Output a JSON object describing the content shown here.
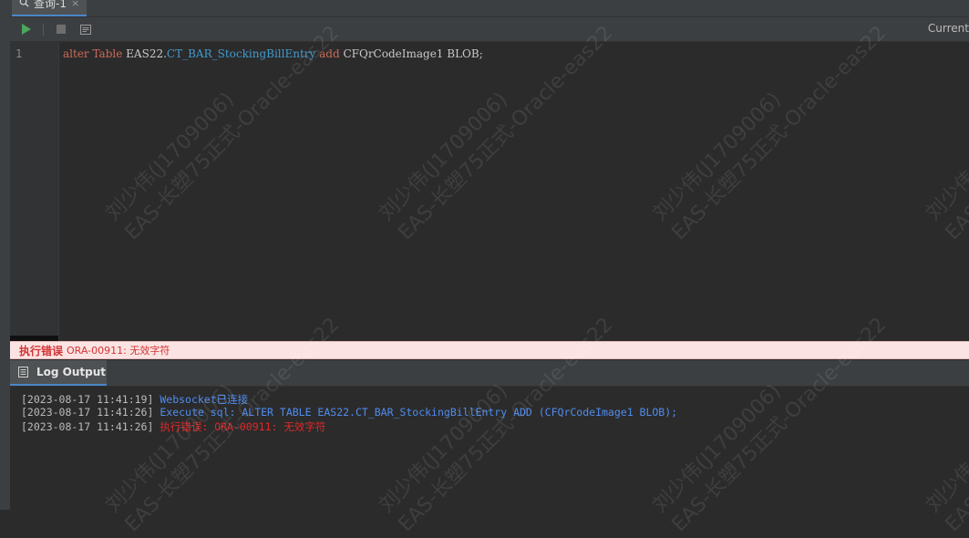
{
  "tab": {
    "label": "查询-1",
    "close": "×"
  },
  "toolbar": {
    "current_label": "Current"
  },
  "editor": {
    "line_number": "1",
    "code": {
      "kw_alter": "alter",
      "kw_table": "Table",
      "schema": "EAS22.",
      "table_name": "CT_BAR_StockingBillEntry",
      "kw_add": "add",
      "rest": "CFQrCodeImage1 BLOB;"
    }
  },
  "error": {
    "title": "执行错误",
    "message": "ORA-00911: 无效字符"
  },
  "log": {
    "tab_label": "Log Output",
    "lines": [
      {
        "timestamp": "[2023-08-17 11:41:19]",
        "message": "Websocket已连接",
        "level": "info"
      },
      {
        "timestamp": "[2023-08-17 11:41:26]",
        "message": "Execute sql: ALTER TABLE EAS22.CT_BAR_StockingBillEntry ADD (CFQrCodeImage1 BLOB);",
        "level": "info"
      },
      {
        "timestamp": "[2023-08-17 11:41:26]",
        "message": "执行错误: ORA-00911: 无效字符",
        "level": "error"
      }
    ]
  },
  "watermark": {
    "line1": "刘少伟(J1709006)",
    "line2": "EAS-长塑75正式-Oracle-eas22"
  },
  "colors": {
    "accent": "#4a88c7",
    "keyword": "#cc6b5a",
    "table": "#3f9bd1",
    "error": "#d33333",
    "info": "#4f8cf0"
  }
}
